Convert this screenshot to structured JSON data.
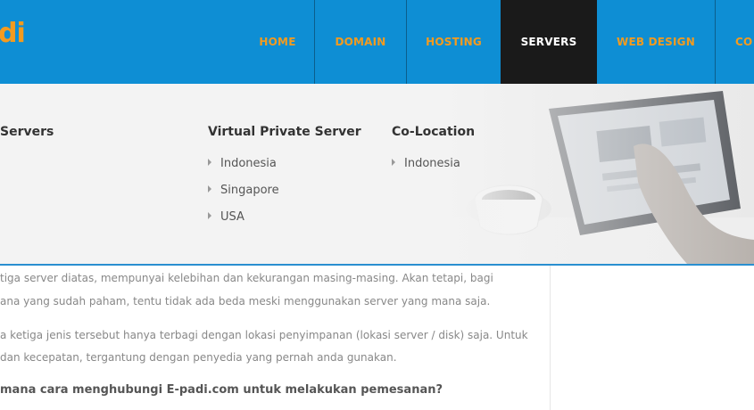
{
  "header": {
    "logo_text": "di",
    "brand_color": "#0e8ed4",
    "accent_color": "#f39b1f",
    "nav": [
      {
        "label": "HOME",
        "active": false
      },
      {
        "label": "DOMAIN",
        "active": false
      },
      {
        "label": "HOSTING",
        "active": false
      },
      {
        "label": "SERVERS",
        "active": true
      },
      {
        "label": "WEB DESIGN",
        "active": false
      },
      {
        "label": "CO",
        "active": false
      }
    ]
  },
  "mega_menu": {
    "columns": [
      {
        "title": "Servers",
        "items": []
      },
      {
        "title": "Virtual Private Server",
        "items": [
          "Indonesia",
          "Singapore",
          "USA"
        ]
      },
      {
        "title": "Co-Location",
        "items": [
          "Indonesia"
        ]
      }
    ]
  },
  "content": {
    "paragraph1": [
      "tiga server diatas, mempunyai kelebihan dan kekurangan masing-masing. Akan tetapi, bagi",
      "ana yang sudah paham, tentu tidak ada beda meski menggunakan server yang mana saja."
    ],
    "paragraph2": [
      "a ketiga jenis tersebut hanya terbagi dengan lokasi penyimpanan (lokasi server / disk) saja. Untuk",
      "dan kecepatan, tergantung dengan penyedia yang pernah anda gunakan."
    ],
    "question": "mana cara menghubungi E-padi.com untuk melakukan pemesanan?"
  }
}
